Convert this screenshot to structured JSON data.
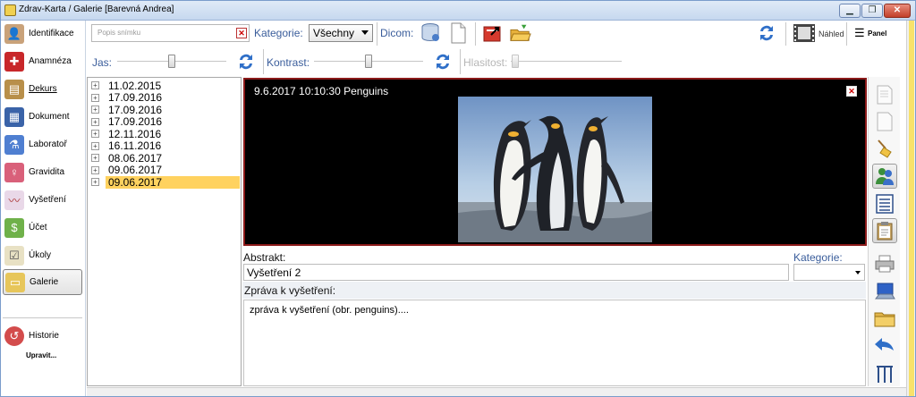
{
  "window": {
    "title": "Zdrav-Karta / Galerie [Barevná Andrea]"
  },
  "sidebar": {
    "items": [
      {
        "label": "Identifikace",
        "icon": "user-icon"
      },
      {
        "label": "Anamnéza",
        "icon": "medkit-icon"
      },
      {
        "label": "Dekurs",
        "icon": "dekurs-icon"
      },
      {
        "label": "Dokument",
        "icon": "document-icon"
      },
      {
        "label": "Laboratoř",
        "icon": "flask-icon"
      },
      {
        "label": "Gravidita",
        "icon": "pregnancy-icon"
      },
      {
        "label": "Vyšetření",
        "icon": "ecg-icon"
      },
      {
        "label": "Účet",
        "icon": "money-icon"
      },
      {
        "label": "Úkoly",
        "icon": "tasks-icon"
      },
      {
        "label": "Galerie",
        "icon": "gallery-icon"
      }
    ],
    "history_label": "Historie",
    "edit_label": "Upravit..."
  },
  "toolbar": {
    "search_placeholder": "Popis snímku",
    "category_label": "Kategorie:",
    "category_value": "Všechny",
    "dicom_label": "Dicom:",
    "preview_label": "Náhled",
    "panel_label": "Panel",
    "brightness_label": "Jas:",
    "contrast_label": "Kontrast:",
    "volume_label": "Hlasitost:",
    "brightness_value": 0.5,
    "contrast_value": 0.5,
    "volume_value": 0
  },
  "tree": {
    "dates": [
      "11.02.2015",
      "17.09.2016",
      "17.09.2016",
      "17.09.2016",
      "12.11.2016",
      "16.11.2016",
      "08.06.2017",
      "09.06.2017",
      "09.06.2017"
    ],
    "selected_index": 8
  },
  "viewer": {
    "caption": "9.6.2017 10:10:30 Penguins"
  },
  "form": {
    "abstract_label": "Abstrakt:",
    "abstract_value": "Vyšetření 2",
    "category_label": "Kategorie:",
    "report_label": "Zpráva k vyšetření:",
    "report_value": "zpráva k vyšetření (obr. penguins)...."
  },
  "colors": {
    "accent_blue": "#3a5d9b",
    "selection": "#ffd25f",
    "viewer_border": "#8b1a1a"
  }
}
